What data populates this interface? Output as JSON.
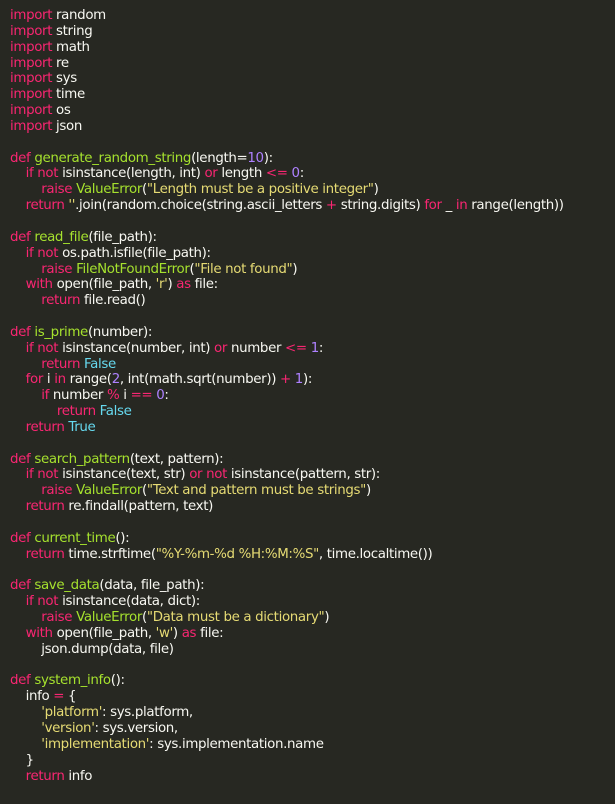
{
  "editor": {
    "theme_colors": {
      "background": "#272822",
      "default": "#f8f8f2",
      "keyword": "#f92672",
      "function": "#a6e22e",
      "number": "#ae81ff",
      "string": "#e6db74",
      "builtin": "#66d9ef"
    },
    "lines": [
      [
        {
          "t": "kw",
          "v": "import"
        },
        {
          "t": "id",
          "v": " random"
        }
      ],
      [
        {
          "t": "kw",
          "v": "import"
        },
        {
          "t": "id",
          "v": " string"
        }
      ],
      [
        {
          "t": "kw",
          "v": "import"
        },
        {
          "t": "id",
          "v": " math"
        }
      ],
      [
        {
          "t": "kw",
          "v": "import"
        },
        {
          "t": "id",
          "v": " re"
        }
      ],
      [
        {
          "t": "kw",
          "v": "import"
        },
        {
          "t": "id",
          "v": " sys"
        }
      ],
      [
        {
          "t": "kw",
          "v": "import"
        },
        {
          "t": "id",
          "v": " time"
        }
      ],
      [
        {
          "t": "kw",
          "v": "import"
        },
        {
          "t": "id",
          "v": " os"
        }
      ],
      [
        {
          "t": "kw",
          "v": "import"
        },
        {
          "t": "id",
          "v": " json"
        }
      ],
      [],
      [
        {
          "t": "kw",
          "v": "def"
        },
        {
          "t": "id",
          "v": " "
        },
        {
          "t": "fn",
          "v": "generate_random_string"
        },
        {
          "t": "id",
          "v": "(length="
        },
        {
          "t": "num",
          "v": "10"
        },
        {
          "t": "id",
          "v": "):"
        }
      ],
      [
        {
          "t": "id",
          "v": "    "
        },
        {
          "t": "kw",
          "v": "if not"
        },
        {
          "t": "id",
          "v": " isinstance(length, int) "
        },
        {
          "t": "kw",
          "v": "or"
        },
        {
          "t": "id",
          "v": " length "
        },
        {
          "t": "kw",
          "v": "<="
        },
        {
          "t": "id",
          "v": " "
        },
        {
          "t": "num",
          "v": "0"
        },
        {
          "t": "id",
          "v": ":"
        }
      ],
      [
        {
          "t": "id",
          "v": "        "
        },
        {
          "t": "kw",
          "v": "raise"
        },
        {
          "t": "id",
          "v": " "
        },
        {
          "t": "fn",
          "v": "ValueError"
        },
        {
          "t": "id",
          "v": "("
        },
        {
          "t": "str",
          "v": "\"Length must be a positive integer\""
        },
        {
          "t": "id",
          "v": ")"
        }
      ],
      [
        {
          "t": "id",
          "v": "    "
        },
        {
          "t": "kw",
          "v": "return"
        },
        {
          "t": "id",
          "v": " "
        },
        {
          "t": "str",
          "v": "''"
        },
        {
          "t": "id",
          "v": ".join(random.choice(string.ascii_letters "
        },
        {
          "t": "kw",
          "v": "+"
        },
        {
          "t": "id",
          "v": " string.digits) "
        },
        {
          "t": "kw",
          "v": "for"
        },
        {
          "t": "id",
          "v": " _ "
        },
        {
          "t": "kw",
          "v": "in"
        },
        {
          "t": "id",
          "v": " range(length))"
        }
      ],
      [],
      [
        {
          "t": "kw",
          "v": "def"
        },
        {
          "t": "id",
          "v": " "
        },
        {
          "t": "fn",
          "v": "read_file"
        },
        {
          "t": "id",
          "v": "(file_path):"
        }
      ],
      [
        {
          "t": "id",
          "v": "    "
        },
        {
          "t": "kw",
          "v": "if not"
        },
        {
          "t": "id",
          "v": " os.path.isfile(file_path):"
        }
      ],
      [
        {
          "t": "id",
          "v": "        "
        },
        {
          "t": "kw",
          "v": "raise"
        },
        {
          "t": "id",
          "v": " "
        },
        {
          "t": "fn",
          "v": "FileNotFoundError"
        },
        {
          "t": "id",
          "v": "("
        },
        {
          "t": "str",
          "v": "\"File not found\""
        },
        {
          "t": "id",
          "v": ")"
        }
      ],
      [
        {
          "t": "id",
          "v": "    "
        },
        {
          "t": "kw",
          "v": "with"
        },
        {
          "t": "id",
          "v": " open(file_path, "
        },
        {
          "t": "str",
          "v": "'r'"
        },
        {
          "t": "id",
          "v": ") "
        },
        {
          "t": "kw",
          "v": "as"
        },
        {
          "t": "id",
          "v": " file:"
        }
      ],
      [
        {
          "t": "id",
          "v": "        "
        },
        {
          "t": "kw",
          "v": "return"
        },
        {
          "t": "id",
          "v": " file.read()"
        }
      ],
      [],
      [
        {
          "t": "kw",
          "v": "def"
        },
        {
          "t": "id",
          "v": " "
        },
        {
          "t": "fn",
          "v": "is_prime"
        },
        {
          "t": "id",
          "v": "(number):"
        }
      ],
      [
        {
          "t": "id",
          "v": "    "
        },
        {
          "t": "kw",
          "v": "if not"
        },
        {
          "t": "id",
          "v": " isinstance(number, int) "
        },
        {
          "t": "kw",
          "v": "or"
        },
        {
          "t": "id",
          "v": " number "
        },
        {
          "t": "kw",
          "v": "<="
        },
        {
          "t": "id",
          "v": " "
        },
        {
          "t": "num",
          "v": "1"
        },
        {
          "t": "id",
          "v": ":"
        }
      ],
      [
        {
          "t": "id",
          "v": "        "
        },
        {
          "t": "kw",
          "v": "return"
        },
        {
          "t": "id",
          "v": " "
        },
        {
          "t": "bi",
          "v": "False"
        }
      ],
      [
        {
          "t": "id",
          "v": "    "
        },
        {
          "t": "kw",
          "v": "for"
        },
        {
          "t": "id",
          "v": " i "
        },
        {
          "t": "kw",
          "v": "in"
        },
        {
          "t": "id",
          "v": " range("
        },
        {
          "t": "num",
          "v": "2"
        },
        {
          "t": "id",
          "v": ", int(math.sqrt(number)) "
        },
        {
          "t": "kw",
          "v": "+"
        },
        {
          "t": "id",
          "v": " "
        },
        {
          "t": "num",
          "v": "1"
        },
        {
          "t": "id",
          "v": "):"
        }
      ],
      [
        {
          "t": "id",
          "v": "        "
        },
        {
          "t": "kw",
          "v": "if"
        },
        {
          "t": "id",
          "v": " number "
        },
        {
          "t": "kw",
          "v": "%"
        },
        {
          "t": "id",
          "v": " i "
        },
        {
          "t": "kw",
          "v": "=="
        },
        {
          "t": "id",
          "v": " "
        },
        {
          "t": "num",
          "v": "0"
        },
        {
          "t": "id",
          "v": ":"
        }
      ],
      [
        {
          "t": "id",
          "v": "            "
        },
        {
          "t": "kw",
          "v": "return"
        },
        {
          "t": "id",
          "v": " "
        },
        {
          "t": "bi",
          "v": "False"
        }
      ],
      [
        {
          "t": "id",
          "v": "    "
        },
        {
          "t": "kw",
          "v": "return"
        },
        {
          "t": "id",
          "v": " "
        },
        {
          "t": "bi",
          "v": "True"
        }
      ],
      [],
      [
        {
          "t": "kw",
          "v": "def"
        },
        {
          "t": "id",
          "v": " "
        },
        {
          "t": "fn",
          "v": "search_pattern"
        },
        {
          "t": "id",
          "v": "(text, pattern):"
        }
      ],
      [
        {
          "t": "id",
          "v": "    "
        },
        {
          "t": "kw",
          "v": "if not"
        },
        {
          "t": "id",
          "v": " isinstance(text, str) "
        },
        {
          "t": "kw",
          "v": "or not"
        },
        {
          "t": "id",
          "v": " isinstance(pattern, str):"
        }
      ],
      [
        {
          "t": "id",
          "v": "        "
        },
        {
          "t": "kw",
          "v": "raise"
        },
        {
          "t": "id",
          "v": " "
        },
        {
          "t": "fn",
          "v": "ValueError"
        },
        {
          "t": "id",
          "v": "("
        },
        {
          "t": "str",
          "v": "\"Text and pattern must be strings\""
        },
        {
          "t": "id",
          "v": ")"
        }
      ],
      [
        {
          "t": "id",
          "v": "    "
        },
        {
          "t": "kw",
          "v": "return"
        },
        {
          "t": "id",
          "v": " re.findall(pattern, text)"
        }
      ],
      [],
      [
        {
          "t": "kw",
          "v": "def"
        },
        {
          "t": "id",
          "v": " "
        },
        {
          "t": "fn",
          "v": "current_time"
        },
        {
          "t": "id",
          "v": "():"
        }
      ],
      [
        {
          "t": "id",
          "v": "    "
        },
        {
          "t": "kw",
          "v": "return"
        },
        {
          "t": "id",
          "v": " time.strftime("
        },
        {
          "t": "str",
          "v": "\"%Y-%m-%d %H:%M:%S\""
        },
        {
          "t": "id",
          "v": ", time.localtime())"
        }
      ],
      [],
      [
        {
          "t": "kw",
          "v": "def"
        },
        {
          "t": "id",
          "v": " "
        },
        {
          "t": "fn",
          "v": "save_data"
        },
        {
          "t": "id",
          "v": "(data, file_path):"
        }
      ],
      [
        {
          "t": "id",
          "v": "    "
        },
        {
          "t": "kw",
          "v": "if not"
        },
        {
          "t": "id",
          "v": " isinstance(data, dict):"
        }
      ],
      [
        {
          "t": "id",
          "v": "        "
        },
        {
          "t": "kw",
          "v": "raise"
        },
        {
          "t": "id",
          "v": " "
        },
        {
          "t": "fn",
          "v": "ValueError"
        },
        {
          "t": "id",
          "v": "("
        },
        {
          "t": "str",
          "v": "\"Data must be a dictionary\""
        },
        {
          "t": "id",
          "v": ")"
        }
      ],
      [
        {
          "t": "id",
          "v": "    "
        },
        {
          "t": "kw",
          "v": "with"
        },
        {
          "t": "id",
          "v": " open(file_path, "
        },
        {
          "t": "str",
          "v": "'w'"
        },
        {
          "t": "id",
          "v": ") "
        },
        {
          "t": "kw",
          "v": "as"
        },
        {
          "t": "id",
          "v": " file:"
        }
      ],
      [
        {
          "t": "id",
          "v": "        json.dump(data, file)"
        }
      ],
      [],
      [
        {
          "t": "kw",
          "v": "def"
        },
        {
          "t": "id",
          "v": " "
        },
        {
          "t": "fn",
          "v": "system_info"
        },
        {
          "t": "id",
          "v": "():"
        }
      ],
      [
        {
          "t": "id",
          "v": "    info "
        },
        {
          "t": "kw",
          "v": "="
        },
        {
          "t": "id",
          "v": " {"
        }
      ],
      [
        {
          "t": "id",
          "v": "        "
        },
        {
          "t": "str",
          "v": "'platform'"
        },
        {
          "t": "id",
          "v": ": sys.platform,"
        }
      ],
      [
        {
          "t": "id",
          "v": "        "
        },
        {
          "t": "str",
          "v": "'version'"
        },
        {
          "t": "id",
          "v": ": sys.version,"
        }
      ],
      [
        {
          "t": "id",
          "v": "        "
        },
        {
          "t": "str",
          "v": "'implementation'"
        },
        {
          "t": "id",
          "v": ": sys.implementation.name"
        }
      ],
      [
        {
          "t": "id",
          "v": "    }"
        }
      ],
      [
        {
          "t": "id",
          "v": "    "
        },
        {
          "t": "kw",
          "v": "return"
        },
        {
          "t": "id",
          "v": " info"
        }
      ]
    ]
  }
}
